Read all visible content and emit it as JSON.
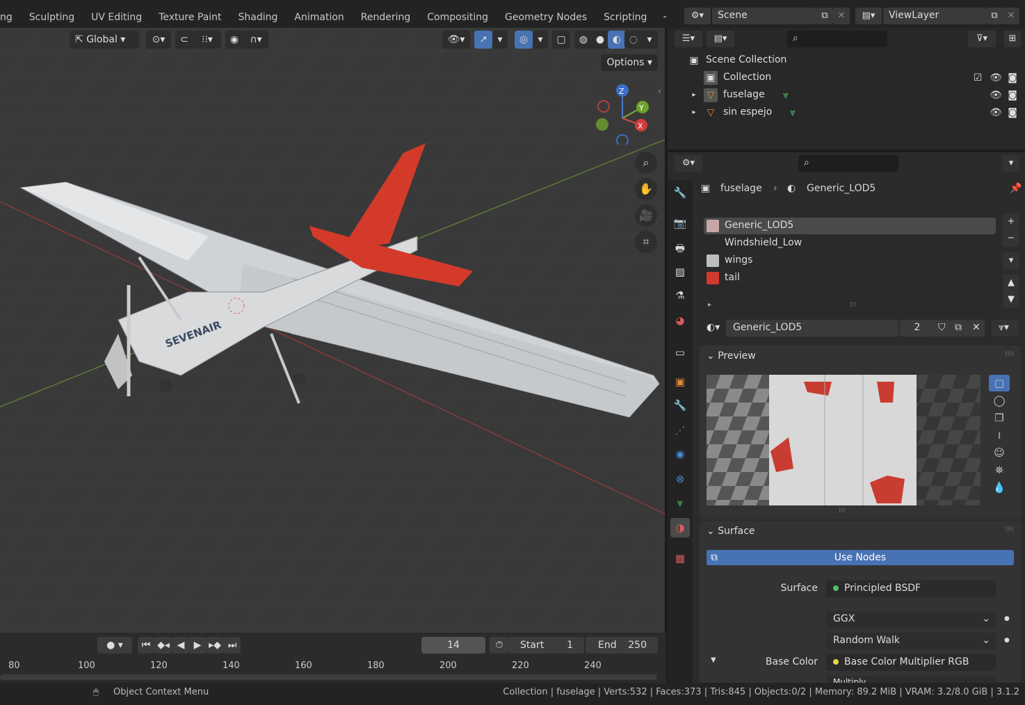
{
  "workspace_tabs": [
    "ng",
    "Sculpting",
    "UV Editing",
    "Texture Paint",
    "Shading",
    "Animation",
    "Rendering",
    "Compositing",
    "Geometry Nodes",
    "Scripting"
  ],
  "scene": {
    "name": "Scene",
    "view_layer": "ViewLayer"
  },
  "viewport": {
    "orientation": "Global",
    "options_label": "Options",
    "gizmo": {
      "z": "Z",
      "y": "Y",
      "x": "X"
    },
    "model_text": "SEVENAIR"
  },
  "timeline": {
    "current_frame": "14",
    "start_label": "Start",
    "start_value": "1",
    "end_label": "End",
    "end_value": "250",
    "ticks": [
      "80",
      "100",
      "120",
      "140",
      "160",
      "180",
      "200",
      "220",
      "240"
    ]
  },
  "outliner": {
    "rows": [
      {
        "label": "Scene Collection"
      },
      {
        "label": "Collection"
      },
      {
        "label": "fuselage"
      },
      {
        "label": "sin espejo"
      }
    ]
  },
  "properties": {
    "breadcrumb_object": "fuselage",
    "breadcrumb_material": "Generic_LOD5",
    "material_slots": [
      {
        "name": "Generic_LOD5",
        "color": "#c9a6a6"
      },
      {
        "name": "Windshield_Low",
        "color": ""
      },
      {
        "name": "wings",
        "color": "#bdbdbd"
      },
      {
        "name": "tail",
        "color": "#d23a2e"
      }
    ],
    "material_name": "Generic_LOD5",
    "user_count": "2",
    "preview_label": "Preview",
    "surface_section_label": "Surface",
    "use_nodes_label": "Use Nodes",
    "surface_label": "Surface",
    "surface_value": "Principled BSDF",
    "distribution": "GGX",
    "subsurface_method": "Random Walk",
    "base_color_label": "Base Color",
    "base_color_value": "Base Color Multiplier RGB",
    "blend_partial": "Multiply"
  },
  "status": {
    "context_menu": "Object Context Menu",
    "stats": "Collection | fuselage | Verts:532 | Faces:373 | Tris:845 | Objects:0/2 | Memory: 89.2 MiB | VRAM: 3.2/8.0 GiB | 3.1.2"
  }
}
